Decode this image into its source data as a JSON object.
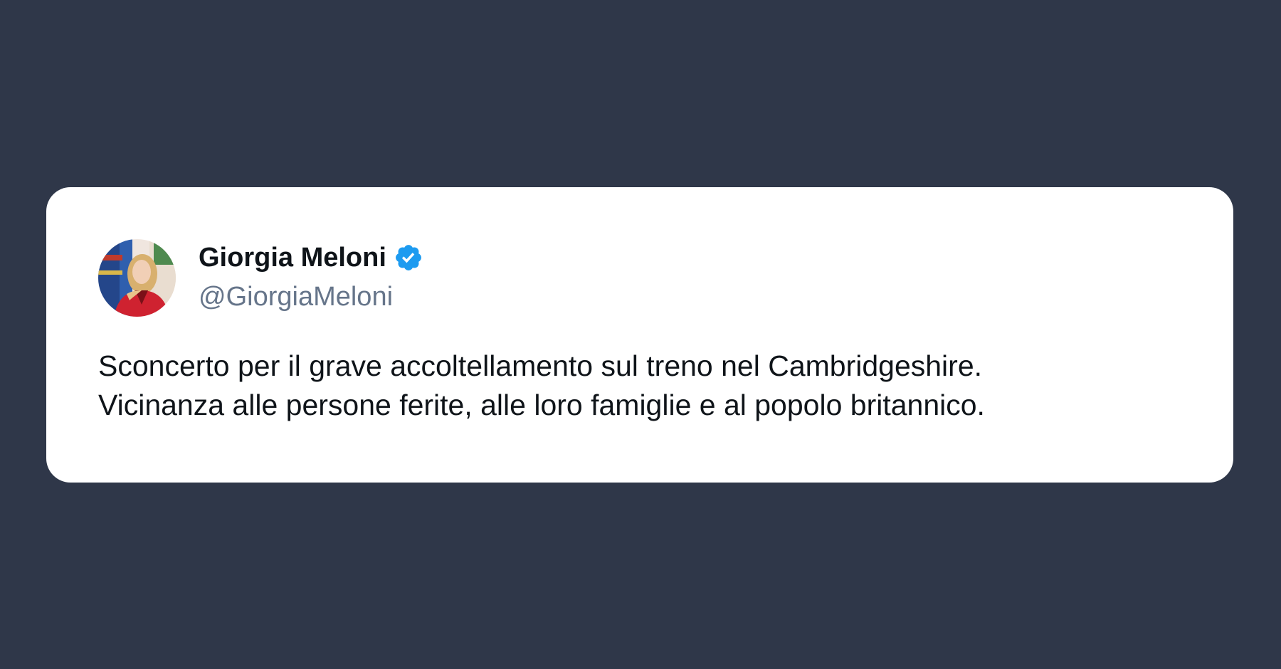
{
  "tweet": {
    "author": {
      "display_name": "Giorgia Meloni",
      "handle": "@GiorgiaMeloni",
      "verified": true,
      "verified_icon": "verified-badge-icon",
      "verified_color": "#1d9bf0"
    },
    "text_lines": [
      "Sconcerto per il grave accoltellamento sul treno nel Cambridgeshire.",
      "Vicinanza alle persone ferite, alle loro famiglie e al popolo britannico."
    ]
  },
  "colors": {
    "background": "#2f3749",
    "card": "#ffffff",
    "text": "#0f1419",
    "handle": "#66758a"
  }
}
